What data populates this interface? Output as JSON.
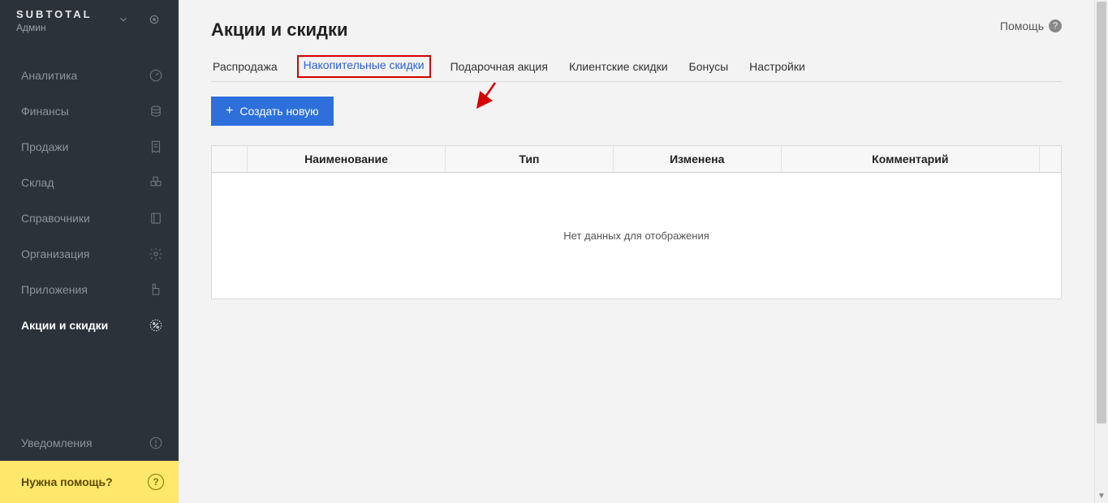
{
  "brand": {
    "name": "SUBTOTAL",
    "role": "Админ"
  },
  "sidebar": {
    "items": [
      {
        "label": "Аналитика",
        "icon": "gauge-icon"
      },
      {
        "label": "Финансы",
        "icon": "coins-icon"
      },
      {
        "label": "Продажи",
        "icon": "receipt-icon"
      },
      {
        "label": "Склад",
        "icon": "boxes-icon"
      },
      {
        "label": "Справочники",
        "icon": "book-icon"
      },
      {
        "label": "Организация",
        "icon": "gear-icon"
      },
      {
        "label": "Приложения",
        "icon": "plugin-icon"
      },
      {
        "label": "Акции и скидки",
        "icon": "percent-icon",
        "active": true
      }
    ],
    "notifications": {
      "label": "Уведомления",
      "icon": "alert-icon"
    },
    "help_footer": {
      "label": "Нужна помощь?"
    }
  },
  "page": {
    "title": "Акции и скидки",
    "help_label": "Помощь"
  },
  "tabs": [
    {
      "label": "Распродажа"
    },
    {
      "label": "Накопительные скидки",
      "active": true,
      "highlight": true
    },
    {
      "label": "Подарочная акция"
    },
    {
      "label": "Клиентские скидки"
    },
    {
      "label": "Бонусы"
    },
    {
      "label": "Настройки"
    }
  ],
  "toolbar": {
    "create_label": "Создать новую"
  },
  "table": {
    "columns": [
      {
        "label": ""
      },
      {
        "label": "Наименование"
      },
      {
        "label": "Тип"
      },
      {
        "label": "Изменена"
      },
      {
        "label": "Комментарий"
      },
      {
        "label": ""
      }
    ],
    "empty_text": "Нет данных для отображения",
    "rows": []
  }
}
